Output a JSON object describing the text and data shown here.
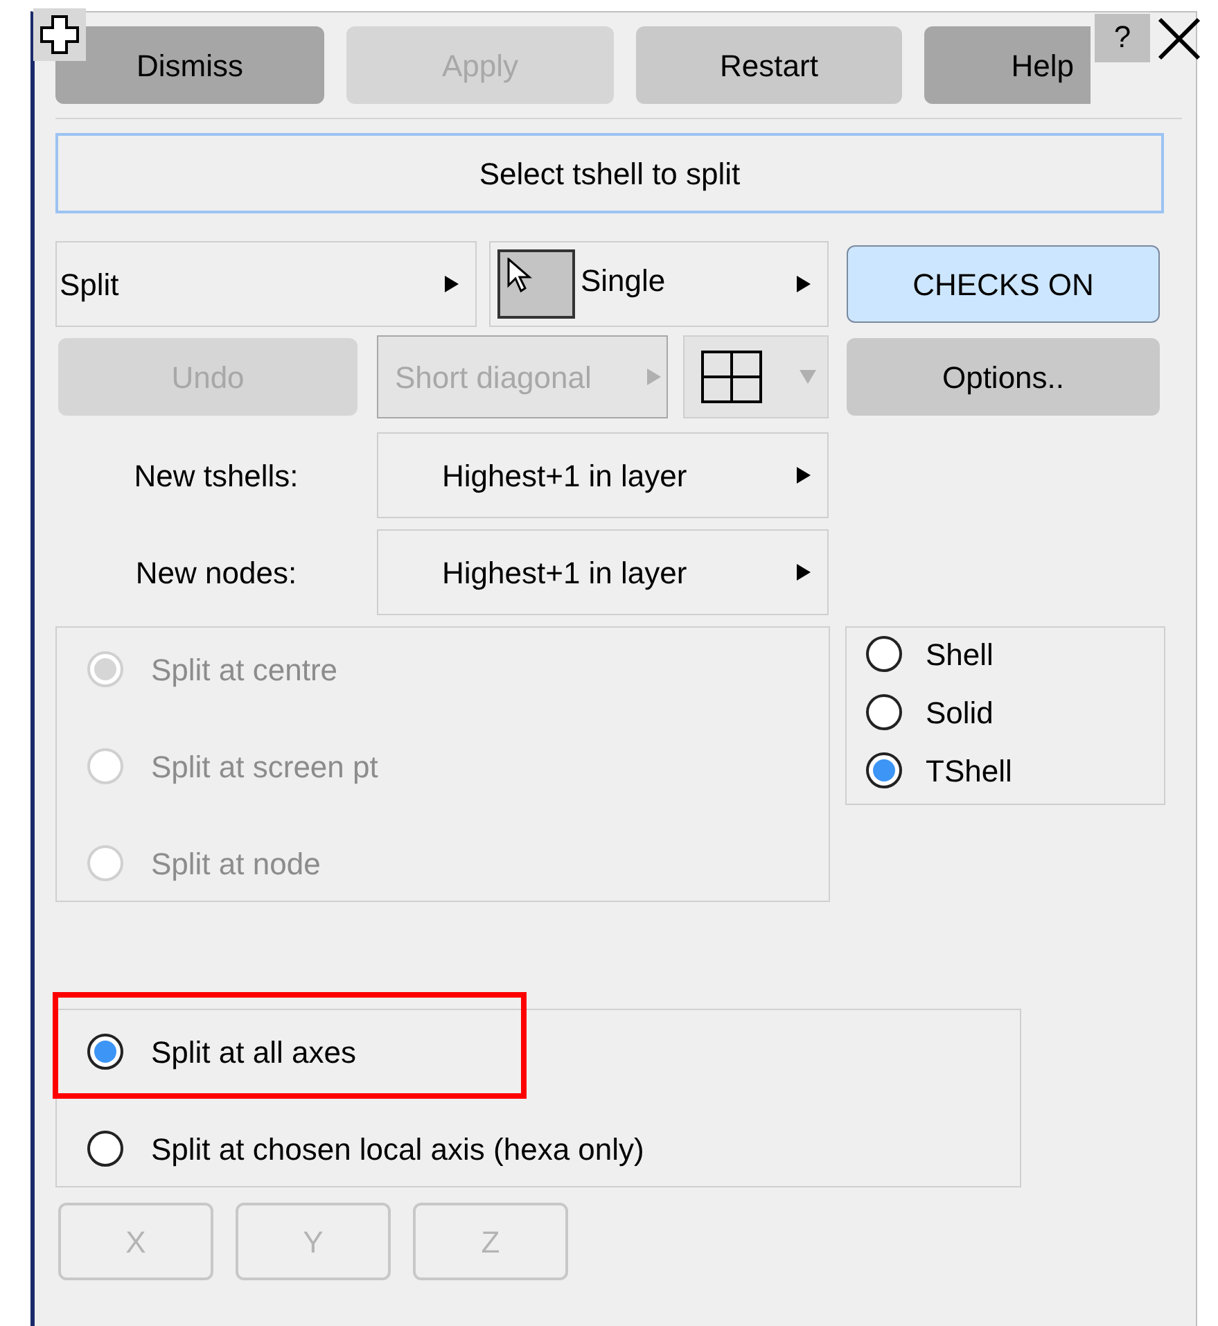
{
  "toolbar": {
    "buttons": [
      {
        "label": "Dismiss",
        "kind": "dark",
        "disabled": false
      },
      {
        "label": "Apply",
        "disabled": true
      },
      {
        "label": "Restart",
        "kind": "light",
        "disabled": false
      },
      {
        "label": "Help",
        "kind": "dark",
        "disabled": false
      }
    ],
    "help_label": "?"
  },
  "prompt": "Select tshell to split",
  "mode_dropdown": {
    "value": "Split"
  },
  "select_dropdown": {
    "value": "Single"
  },
  "checks_button": {
    "label": "CHECKS ON",
    "on": true
  },
  "undo_button": {
    "label": "Undo",
    "disabled": true
  },
  "diagonal_dropdown": {
    "value": "Short diagonal",
    "disabled": true
  },
  "options_button": {
    "label": "Options.."
  },
  "numbering": [
    {
      "label": "New tshells:",
      "value": "Highest+1 in layer"
    },
    {
      "label": "New nodes:",
      "value": "Highest+1 in layer"
    }
  ],
  "split_location": {
    "disabled": true,
    "options": [
      {
        "label": "Split at centre",
        "selected": true
      },
      {
        "label": "Split at screen pt",
        "selected": false
      },
      {
        "label": "Split at node",
        "selected": false
      }
    ]
  },
  "element_type": {
    "options": [
      {
        "label": "Shell",
        "selected": false
      },
      {
        "label": "Solid",
        "selected": false
      },
      {
        "label": "TShell",
        "selected": true
      }
    ]
  },
  "axes": {
    "options": [
      {
        "label": "Split at all axes",
        "selected": true,
        "highlighted": true
      },
      {
        "label": "Split at chosen local axis (hexa only)",
        "selected": false,
        "highlighted": false
      }
    ]
  },
  "axis_buttons": [
    {
      "label": "X",
      "disabled": true
    },
    {
      "label": "Y",
      "disabled": true
    },
    {
      "label": "Z",
      "disabled": true
    }
  ]
}
